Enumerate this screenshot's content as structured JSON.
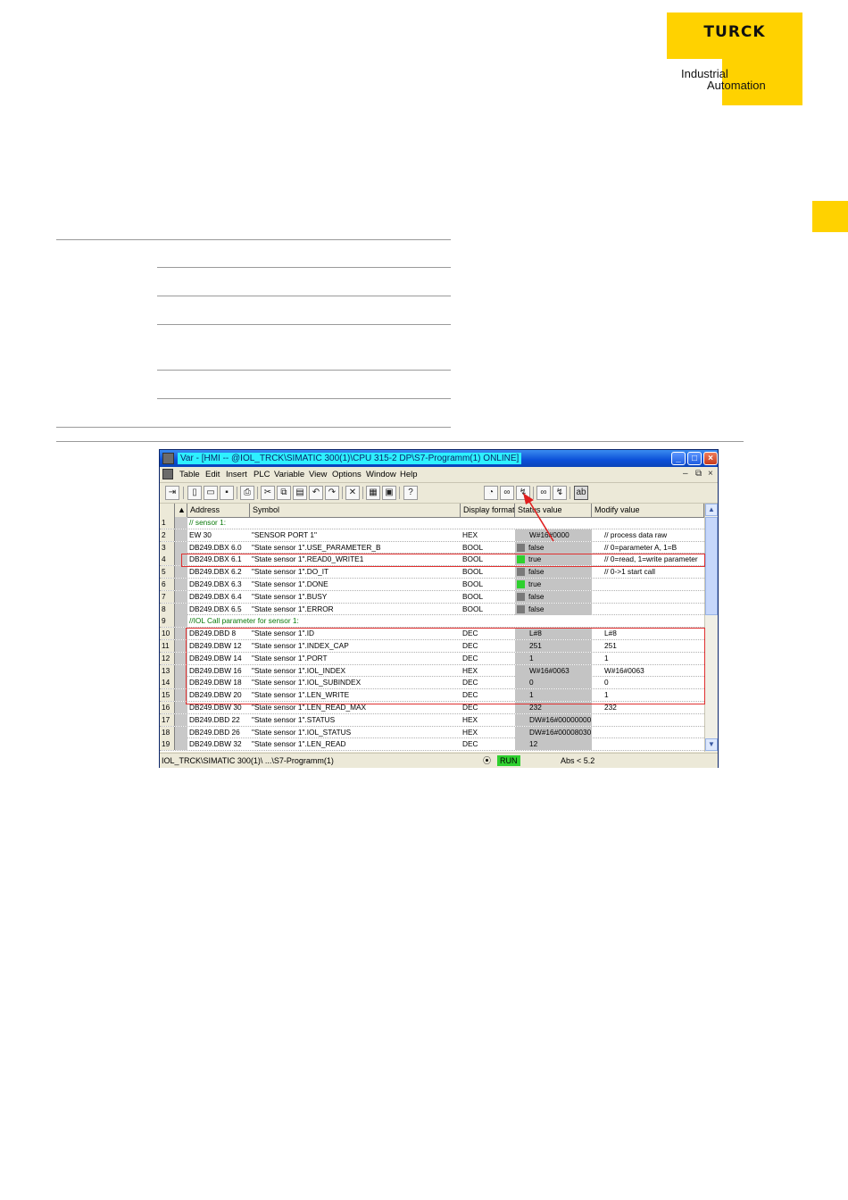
{
  "logo": {
    "word": "TURCK",
    "line1": "Industrial",
    "line2": "Automation"
  },
  "window": {
    "title": "Var - [HMI -- @IOL_TRCK\\SIMATIC 300(1)\\CPU 315-2 DP\\S7-Programm(1)  ONLINE]",
    "buttons": {
      "minimize": "_",
      "maximize": "□",
      "close": "×"
    }
  },
  "menu": {
    "items": [
      "Table",
      "Edit",
      "Insert",
      "PLC",
      "Variable",
      "View",
      "Options",
      "Window",
      "Help"
    ],
    "mdi": {
      "minimize": "–",
      "restore": "⧉",
      "close": "×"
    }
  },
  "grid": {
    "headers": {
      "address": "Address",
      "symbol": "Symbol",
      "format": "Display format",
      "status": "Status value",
      "modify": "Modify value"
    },
    "rows": [
      {
        "n": "1",
        "comment": "// sensor 1:"
      },
      {
        "n": "2",
        "address": "EW   30",
        "symbol": "\"SENSOR PORT 1\"",
        "format": "HEX",
        "status": "W#16#0000",
        "modify": "",
        "note": "// process data raw"
      },
      {
        "n": "3",
        "address": "DB249.DBX   6.0",
        "symbol": "\"State sensor 1\".USE_PARAMETER_B",
        "format": "BOOL",
        "status": "false",
        "led": "off",
        "modify": "",
        "note": "// 0=parameter A, 1=B"
      },
      {
        "n": "4",
        "address": "DB249.DBX   6.1",
        "symbol": "\"State sensor 1\".READ0_WRITE1",
        "format": "BOOL",
        "status": "true",
        "led": "on",
        "modify": "",
        "note": "// 0=read, 1=write parameter"
      },
      {
        "n": "5",
        "address": "DB249.DBX   6.2",
        "symbol": "\"State sensor 1\".DO_IT",
        "format": "BOOL",
        "status": "false",
        "led": "off",
        "modify": "",
        "note": "// 0->1 start call"
      },
      {
        "n": "6",
        "address": "DB249.DBX   6.3",
        "symbol": "\"State sensor 1\".DONE",
        "format": "BOOL",
        "status": "true",
        "led": "on",
        "modify": "",
        "note": ""
      },
      {
        "n": "7",
        "address": "DB249.DBX   6.4",
        "symbol": "\"State sensor 1\".BUSY",
        "format": "BOOL",
        "status": "false",
        "led": "off",
        "modify": "",
        "note": ""
      },
      {
        "n": "8",
        "address": "DB249.DBX   6.5",
        "symbol": "\"State sensor 1\".ERROR",
        "format": "BOOL",
        "status": "false",
        "led": "off",
        "modify": "",
        "note": ""
      },
      {
        "n": "9",
        "comment": "//IOL Call parameter for sensor 1:"
      },
      {
        "n": "10",
        "address": "DB249.DBD   8",
        "symbol": "\"State sensor 1\".ID",
        "format": "DEC",
        "status": "L#8",
        "modify": "L#8",
        "note": ""
      },
      {
        "n": "11",
        "address": "DB249.DBW   12",
        "symbol": "\"State sensor 1\".INDEX_CAP",
        "format": "DEC",
        "status": "251",
        "modify": "251",
        "note": ""
      },
      {
        "n": "12",
        "address": "DB249.DBW   14",
        "symbol": "\"State sensor 1\".PORT",
        "format": "DEC",
        "status": "1",
        "modify": "1",
        "note": ""
      },
      {
        "n": "13",
        "address": "DB249.DBW   16",
        "symbol": "\"State sensor 1\".IOL_INDEX",
        "format": "HEX",
        "status": "W#16#0063",
        "modify": "W#16#0063",
        "note": ""
      },
      {
        "n": "14",
        "address": "DB249.DBW   18",
        "symbol": "\"State sensor 1\".IOL_SUBINDEX",
        "format": "DEC",
        "status": "0",
        "modify": "0",
        "note": ""
      },
      {
        "n": "15",
        "address": "DB249.DBW   20",
        "symbol": "\"State sensor 1\".LEN_WRITE",
        "format": "DEC",
        "status": "1",
        "modify": "1",
        "note": ""
      },
      {
        "n": "16",
        "address": "DB249.DBW   30",
        "symbol": "\"State sensor 1\".LEN_READ_MAX",
        "format": "DEC",
        "status": "232",
        "modify": "232",
        "note": ""
      },
      {
        "n": "17",
        "address": "DB249.DBD   22",
        "symbol": "\"State sensor 1\".STATUS",
        "format": "HEX",
        "status": "DW#16#00000000",
        "modify": "",
        "note": ""
      },
      {
        "n": "18",
        "address": "DB249.DBD   26",
        "symbol": "\"State sensor 1\".IOL_STATUS",
        "format": "HEX",
        "status": "DW#16#00008030",
        "modify": "",
        "note": ""
      },
      {
        "n": "19",
        "address": "DB249.DBW   32",
        "symbol": "\"State sensor 1\".LEN_READ",
        "format": "DEC",
        "status": "12",
        "modify": "",
        "note": ""
      }
    ]
  },
  "statusbar": {
    "path": "IOL_TRCK\\SIMATIC 300(1)\\ ...\\S7-Programm(1)",
    "mode": "RUN",
    "abs": "Abs < 5.2"
  },
  "colors": {
    "accent_yellow": "#ffd200",
    "highlight_red": "#e03030",
    "led_on": "#2fd02f"
  }
}
